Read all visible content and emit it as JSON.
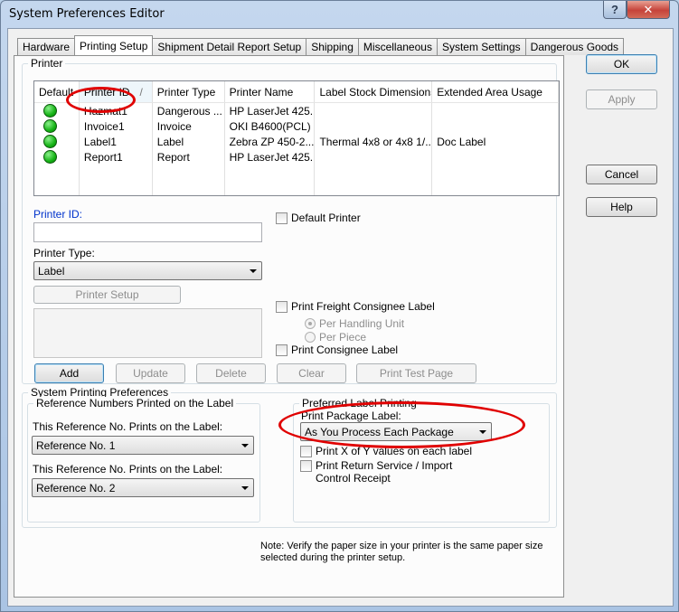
{
  "window": {
    "title": "System Preferences Editor"
  },
  "titlebar": {
    "help_glyph": "?",
    "close_glyph": "✕"
  },
  "tabs": [
    {
      "label": "Hardware"
    },
    {
      "label": "Printing Setup"
    },
    {
      "label": "Shipment Detail Report Setup"
    },
    {
      "label": "Shipping"
    },
    {
      "label": "Miscellaneous"
    },
    {
      "label": "System Settings"
    },
    {
      "label": "Dangerous Goods"
    }
  ],
  "printer_group": {
    "label": "Printer",
    "columns": [
      "Default",
      "Printer ID",
      "Printer Type",
      "Printer Name",
      "Label Stock Dimensions",
      "Extended Area Usage"
    ],
    "sort_indicator": "/",
    "rows": [
      {
        "id": "Hazmat1",
        "type": "Dangerous ...",
        "name": "HP LaserJet 425...",
        "dims": "",
        "usage": ""
      },
      {
        "id": "Invoice1",
        "type": "Invoice",
        "name": "OKI B4600(PCL)",
        "dims": "",
        "usage": ""
      },
      {
        "id": "Label1",
        "type": "Label",
        "name": "Zebra  ZP 450-2...",
        "dims": "Thermal 4x8 or 4x8 1/...",
        "usage": "Doc Label"
      },
      {
        "id": "Report1",
        "type": "Report",
        "name": "HP LaserJet 425...",
        "dims": "",
        "usage": ""
      }
    ],
    "printer_id_label": "Printer ID:",
    "printer_id_value": "",
    "default_printer_label": "Default Printer",
    "printer_type_label": "Printer Type:",
    "printer_type_value": "Label",
    "printer_setup_button": "Printer Setup",
    "freight_label": "Print Freight Consignee Label",
    "per_handling_unit": "Per Handling Unit",
    "per_piece": "Per Piece",
    "consignee_label": "Print Consignee Label",
    "buttons": {
      "add": "Add",
      "update": "Update",
      "delete": "Delete",
      "clear": "Clear",
      "test": "Print Test Page"
    }
  },
  "printing_prefs": {
    "label": "System Printing Preferences",
    "ref_group_label": "Reference Numbers Printed on the Label",
    "ref1_label": "This Reference No. Prints on the Label:",
    "ref1_value": "Reference No. 1",
    "ref2_label": "This Reference No. Prints on the Label:",
    "ref2_value": "Reference No. 2",
    "pref_group_label": "Preferred Label Printing",
    "package_label": "Print Package Label:",
    "package_value": "As You Process Each Package",
    "x_of_y_label": "Print X of Y values on each label",
    "return_label": "Print Return Service / Import Control Receipt"
  },
  "note": "Note: Verify the paper size in your printer is the same paper size selected during the printer setup.",
  "side_buttons": {
    "ok": "OK",
    "apply": "Apply",
    "cancel": "Cancel",
    "help": "Help"
  },
  "colors": {
    "status_dot": "#15b315",
    "annotation": "#e00000",
    "printer_id_label": "#0033cc"
  }
}
